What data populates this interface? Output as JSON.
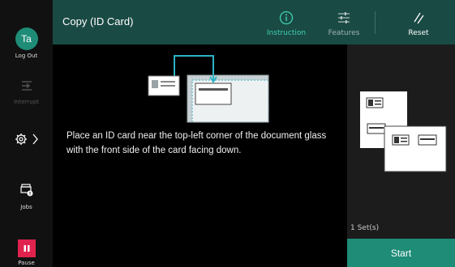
{
  "user": {
    "initials": "Ta",
    "logout_label": "Log Out"
  },
  "rail": {
    "interrupt_label": "Interrupt",
    "jobs_label": "Jobs",
    "pause_label": "Pause"
  },
  "header": {
    "title": "Copy (ID Card)",
    "instruction_label": "Instruction",
    "features_label": "Features",
    "reset_label": "Reset"
  },
  "main": {
    "instruction_text": "Place an ID card near the top-left corner of the document glass with the front side of the card facing down."
  },
  "panel": {
    "sets_label": "1 Set(s)",
    "start_label": "Start"
  },
  "colors": {
    "accent": "#1e8c77",
    "header_bg": "#1a4a44",
    "pause": "#e0224e",
    "active_tab": "#3fd2b4"
  }
}
